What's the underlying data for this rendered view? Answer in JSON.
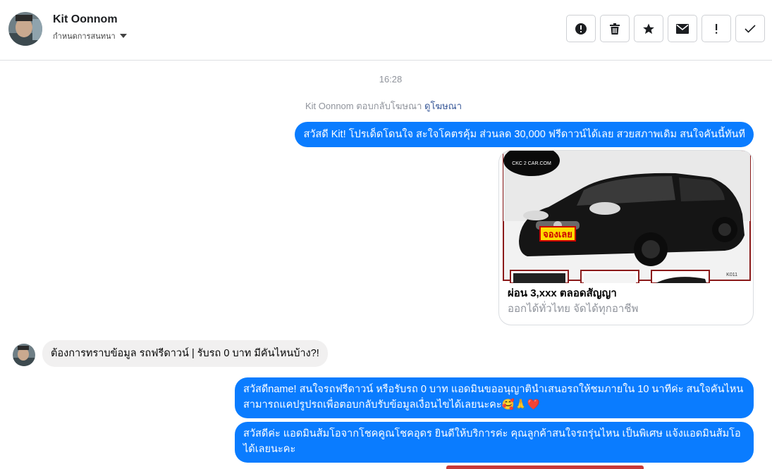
{
  "header": {
    "contact_name": "Kit Oonnom",
    "settings_label": "กำหนดการสนทนา",
    "actions": [
      {
        "name": "report-icon"
      },
      {
        "name": "trash-icon"
      },
      {
        "name": "star-icon"
      },
      {
        "name": "mail-icon"
      },
      {
        "name": "exclamation-icon"
      },
      {
        "name": "check-icon"
      }
    ]
  },
  "thread": {
    "timestamp": "16:28",
    "ad_reply_text": "Kit Oonnom ตอบกลับโฆษณา ",
    "ad_reply_link": "ดูโฆษณา",
    "msg1": "สวัสดี Kit! โปรเด็ดโดนใจ สะใจโคตรคุ้ม ส่วนลด 30,000 ฟรีดาวน์ได้เลย สวยสภาพเดิม สนใจคันนี้ทันที",
    "ad_card": {
      "logo_text": "CKC 2 CAR.COM",
      "sticker_text": "จองเลย",
      "code": "K011",
      "title": "ผ่อน 3,xxx ตลอดสัญญา",
      "subtitle": "ออกได้ทั่วไทย จัดได้ทุกอาชีพ"
    },
    "msg_in": "ต้องการทราบข้อมูล รถฟรีดาวน์ | รับรถ 0 บาท มีคันไหนบ้าง?!",
    "msg2": "สวัสดีname! สนใจรถฟรีดาวน์ หรือรับรถ 0 บาท แอดมินขออนุญาตินำเสนอรถให้ชมภายใน 10 นาทีค่ะ สนใจคันไหนสามารถแคปรูปรถเพื่อตอบกลับรับข้อมูลเงื่อนไขได้เลยนะคะ🥰🙏❤️",
    "msg3": "สวัสดีค่ะ แอดมินส้มโอจากโชคคูณโชคอุดร ยินดีให้บริการค่ะ  คุณลูกค้าสนใจรถรุ่นไหน เป็นพิเศษ แจ้งแอดมินส้มโอ ได้เลยนะคะ"
  },
  "colors": {
    "outgoing_bubble": "#0a7cff",
    "incoming_bubble": "#f1f0f0",
    "link": "#385898",
    "meta_text": "#90949c"
  }
}
